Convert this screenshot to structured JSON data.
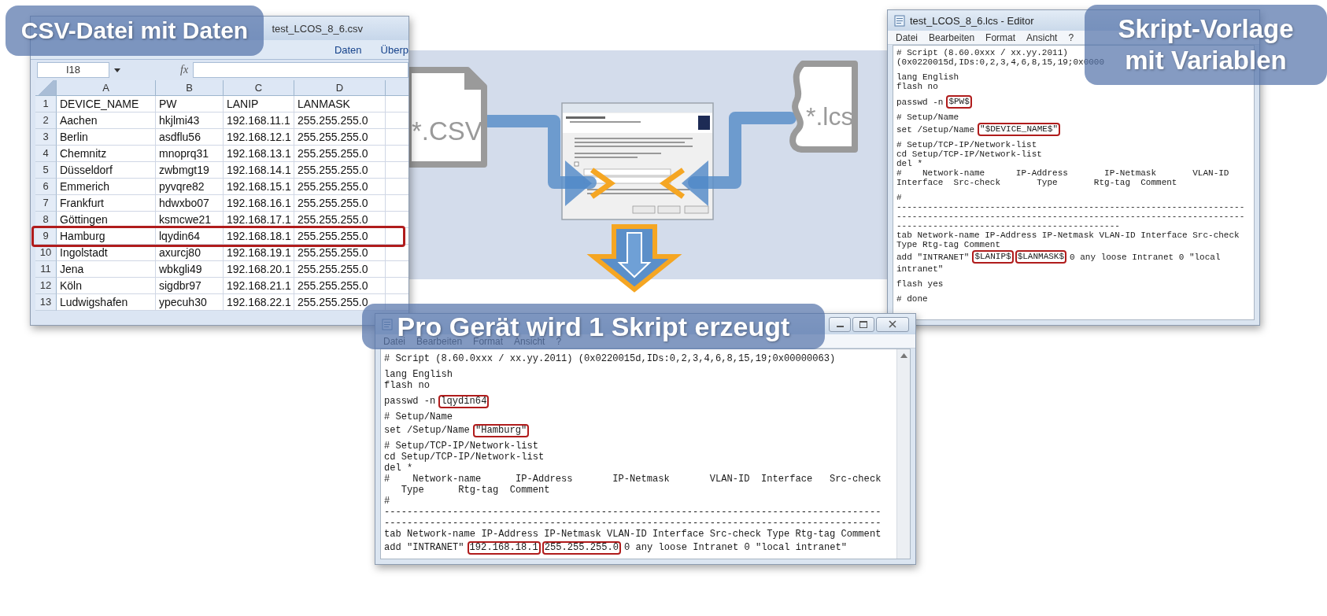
{
  "csv_window": {
    "title": "test_LCOS_8_6.csv",
    "ribbon_tabs": [
      {
        "label": "Daten"
      },
      {
        "label": "Überp"
      }
    ],
    "name_box": "I18",
    "formula_label": "fx",
    "columns": [
      "A",
      "B",
      "C",
      "D"
    ],
    "rows": [
      {
        "number": "1",
        "cells": [
          "DEVICE_NAME",
          "PW",
          "LANIP",
          "LANMASK"
        ],
        "highlighted": false
      },
      {
        "number": "2",
        "cells": [
          "Aachen",
          "hkjlmi43",
          "192.168.11.1",
          "255.255.255.0"
        ],
        "highlighted": false
      },
      {
        "number": "3",
        "cells": [
          "Berlin",
          "asdflu56",
          "192.168.12.1",
          "255.255.255.0"
        ],
        "highlighted": false
      },
      {
        "number": "4",
        "cells": [
          "Chemnitz",
          "mnoprq31",
          "192.168.13.1",
          "255.255.255.0"
        ],
        "highlighted": false
      },
      {
        "number": "5",
        "cells": [
          "Düsseldorf",
          "zwbmgt19",
          "192.168.14.1",
          "255.255.255.0"
        ],
        "highlighted": false
      },
      {
        "number": "6",
        "cells": [
          "Emmerich",
          "pyvqre82",
          "192.168.15.1",
          "255.255.255.0"
        ],
        "highlighted": false
      },
      {
        "number": "7",
        "cells": [
          "Frankfurt",
          "hdwxbo07",
          "192.168.16.1",
          "255.255.255.0"
        ],
        "highlighted": false
      },
      {
        "number": "8",
        "cells": [
          "Göttingen",
          "ksmcwe21",
          "192.168.17.1",
          "255.255.255.0"
        ],
        "highlighted": false
      },
      {
        "number": "9",
        "cells": [
          "Hamburg",
          "lqydin64",
          "192.168.18.1",
          "255.255.255.0"
        ],
        "highlighted": true
      },
      {
        "number": "10",
        "cells": [
          "Ingolstadt",
          "axurcj80",
          "192.168.19.1",
          "255.255.255.0"
        ],
        "highlighted": false
      },
      {
        "number": "11",
        "cells": [
          "Jena",
          "wbkgli49",
          "192.168.20.1",
          "255.255.255.0"
        ],
        "highlighted": false
      },
      {
        "number": "12",
        "cells": [
          "Köln",
          "sigdbr97",
          "192.168.21.1",
          "255.255.255.0"
        ],
        "highlighted": false
      },
      {
        "number": "13",
        "cells": [
          "Ludwigshafen",
          "ypecuh30",
          "192.168.22.1",
          "255.255.255.0"
        ],
        "highlighted": false
      }
    ]
  },
  "flow": {
    "source_label": "*.CSV",
    "template_label": "*.lcs"
  },
  "template_editor": {
    "title": "test_LCOS_8_6.lcs - Editor",
    "menu": [
      "Datei",
      "Bearbeiten",
      "Format",
      "Ansicht",
      "?"
    ],
    "blocks": [
      {
        "lines": [
          {
            "parts": [
              {
                "text": "# Script (8.60.0xxx / xx.yy.2011)",
                "marked": false
              }
            ]
          },
          {
            "parts": [
              {
                "text": "(0x0220015d,IDs:0,2,3,4,6,8,15,19;0x0000",
                "marked": false
              }
            ]
          }
        ]
      },
      {
        "lines": [
          {
            "parts": [
              {
                "text": "lang English",
                "marked": false
              }
            ]
          },
          {
            "parts": [
              {
                "text": "flash no",
                "marked": false
              }
            ]
          }
        ]
      },
      {
        "lines": [
          {
            "parts": [
              {
                "text": "passwd -n",
                "marked": false
              },
              {
                "text": "$PW$",
                "marked": true
              }
            ]
          }
        ]
      },
      {
        "lines": [
          {
            "parts": [
              {
                "text": "# Setup/Name",
                "marked": false
              }
            ]
          },
          {
            "parts": [
              {
                "text": "set /Setup/Name",
                "marked": false
              },
              {
                "text": "\"$DEVICE_NAME$\"",
                "marked": true
              }
            ]
          }
        ]
      },
      {
        "lines": [
          {
            "parts": [
              {
                "text": "# Setup/TCP-IP/Network-list",
                "marked": false
              }
            ]
          },
          {
            "parts": [
              {
                "text": "cd Setup/TCP-IP/Network-list",
                "marked": false
              }
            ]
          },
          {
            "parts": [
              {
                "text": "del *",
                "marked": false
              }
            ]
          },
          {
            "parts": [
              {
                "text": "#    Network-name      IP-Address       IP-Netmask       VLAN-ID",
                "marked": false
              }
            ]
          },
          {
            "parts": [
              {
                "text": "Interface  Src-check       Type       Rtg-tag  Comment",
                "marked": false
              }
            ]
          }
        ]
      },
      {
        "lines": [
          {
            "parts": [
              {
                "text": "#",
                "marked": false
              }
            ]
          },
          {
            "parts": [
              {
                "text": "-------------------------------------------------------------------",
                "marked": false
              }
            ]
          },
          {
            "parts": [
              {
                "text": "-------------------------------------------------------------------",
                "marked": false
              }
            ]
          },
          {
            "parts": [
              {
                "text": "-------------------------------------------",
                "marked": false
              }
            ]
          },
          {
            "parts": [
              {
                "text": "tab Network-name IP-Address IP-Netmask VLAN-ID Interface Src-check",
                "marked": false
              }
            ]
          },
          {
            "parts": [
              {
                "text": "Type Rtg-tag Comment",
                "marked": false
              }
            ]
          },
          {
            "parts": [
              {
                "text": "add \"INTRANET\"",
                "marked": false
              },
              {
                "text": "$LANIP$",
                "marked": true
              },
              {
                "text": "$LANMASK$",
                "marked": true
              },
              {
                "text": "0 any loose Intranet 0 \"local",
                "marked": false
              }
            ]
          },
          {
            "parts": [
              {
                "text": "intranet\"",
                "marked": false
              }
            ]
          }
        ]
      },
      {
        "lines": [
          {
            "parts": [
              {
                "text": "flash yes",
                "marked": false
              }
            ]
          }
        ]
      },
      {
        "lines": [
          {
            "parts": [
              {
                "text": "# done",
                "marked": false
              }
            ]
          }
        ]
      }
    ]
  },
  "output_editor": {
    "menu": [
      "Datei",
      "Bearbeiten",
      "Format",
      "Ansicht",
      "?"
    ],
    "blocks": [
      {
        "lines": [
          {
            "parts": [
              {
                "text": "# Script (8.60.0xxx / xx.yy.2011) (0x0220015d,IDs:0,2,3,4,6,8,15,19;0x00000063)",
                "marked": false
              }
            ]
          }
        ]
      },
      {
        "lines": [
          {
            "parts": [
              {
                "text": "lang English",
                "marked": false
              }
            ]
          },
          {
            "parts": [
              {
                "text": "flash no",
                "marked": false
              }
            ]
          }
        ]
      },
      {
        "lines": [
          {
            "parts": [
              {
                "text": "passwd -n",
                "marked": false
              },
              {
                "text": "lqydin64",
                "marked": true
              }
            ]
          }
        ]
      },
      {
        "lines": [
          {
            "parts": [
              {
                "text": "# Setup/Name",
                "marked": false
              }
            ]
          },
          {
            "parts": [
              {
                "text": "set /Setup/Name",
                "marked": false
              },
              {
                "text": "\"Hamburg\"",
                "marked": true
              }
            ]
          }
        ]
      },
      {
        "lines": [
          {
            "parts": [
              {
                "text": "# Setup/TCP-IP/Network-list",
                "marked": false
              }
            ]
          },
          {
            "parts": [
              {
                "text": "cd Setup/TCP-IP/Network-list",
                "marked": false
              }
            ]
          },
          {
            "parts": [
              {
                "text": "del *",
                "marked": false
              }
            ]
          },
          {
            "parts": [
              {
                "text": "#    Network-name      IP-Address       IP-Netmask       VLAN-ID  Interface   Src-check",
                "marked": false
              }
            ]
          },
          {
            "parts": [
              {
                "text": "   Type      Rtg-tag  Comment",
                "marked": false
              }
            ]
          },
          {
            "parts": [
              {
                "text": "#",
                "marked": false
              }
            ]
          },
          {
            "parts": [
              {
                "text": "---------------------------------------------------------------------------------------",
                "marked": false
              }
            ]
          },
          {
            "parts": [
              {
                "text": "---------------------------------------------------------------------------------------",
                "marked": false
              }
            ]
          },
          {
            "parts": [
              {
                "text": "tab Network-name IP-Address IP-Netmask VLAN-ID Interface Src-check Type Rtg-tag Comment",
                "marked": false
              }
            ]
          },
          {
            "parts": [
              {
                "text": "add \"INTRANET\"",
                "marked": false
              },
              {
                "text": "192.168.18.1",
                "marked": true
              },
              {
                "text": "255.255.255.0",
                "marked": true
              },
              {
                "text": "0 any loose Intranet 0 \"local intranet\"",
                "marked": false
              }
            ]
          }
        ]
      }
    ]
  },
  "captions": [
    {
      "text": "CSV-Datei mit Daten"
    },
    {
      "text": "Skript-Vorlage mit Variablen"
    },
    {
      "text": "Pro Gerät wird 1 Skript erzeugt"
    }
  ]
}
